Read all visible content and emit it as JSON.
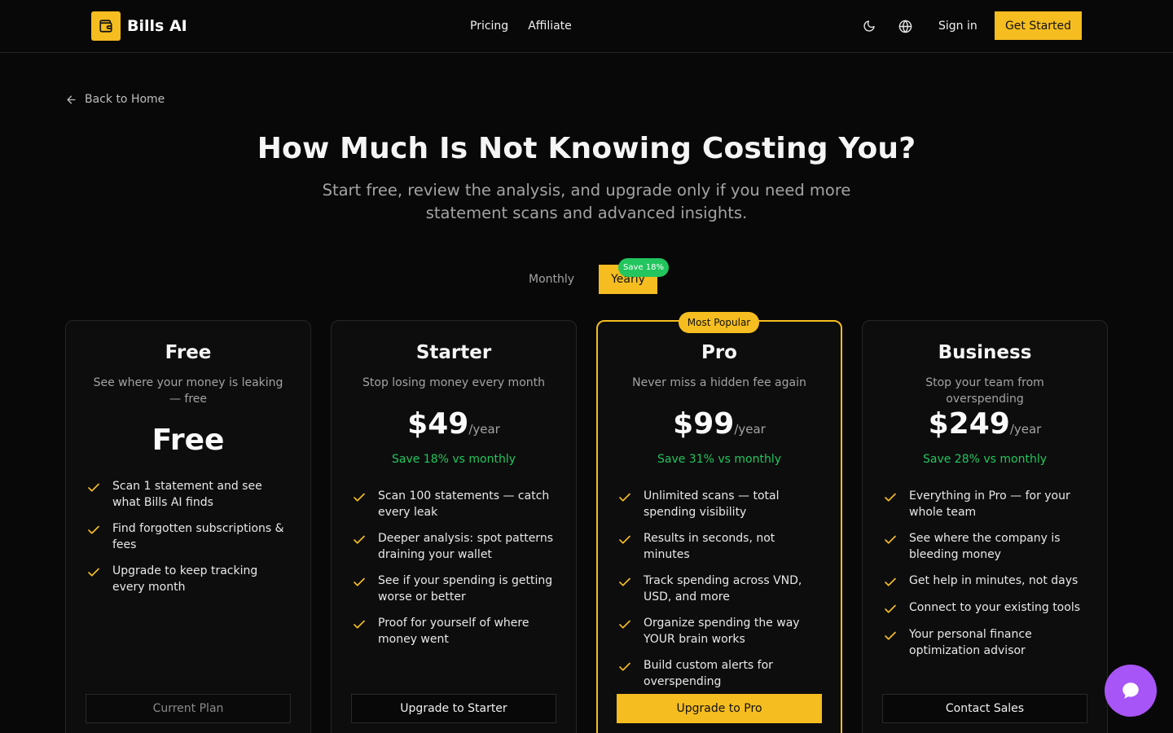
{
  "header": {
    "brand": "Bills AI",
    "nav": [
      {
        "label": "Pricing"
      },
      {
        "label": "Affiliate"
      }
    ],
    "theme_icon": "moon-icon",
    "language_icon": "globe-icon",
    "signin": "Sign in",
    "cta": "Get Started"
  },
  "back_link": "Back to Home",
  "hero": {
    "title": "How Much Is Not Knowing Costing You?",
    "subtitle": "Start free, review the analysis, and upgrade only if you need more statement scans and advanced insights."
  },
  "billing_toggle": {
    "monthly": "Monthly",
    "yearly": "Yearly",
    "yearly_selected": true,
    "save_badge": "Save 18%"
  },
  "plans": [
    {
      "name": "Free",
      "description": "See where your money is leaking — free",
      "price": "Free",
      "features": [
        "Scan 1 statement and see what Bills AI finds",
        "Find forgotten subscriptions & fees",
        "Upgrade to keep tracking every month"
      ],
      "button": "Current Plan"
    },
    {
      "name": "Starter",
      "description": "Stop losing money every month",
      "price": "$49",
      "period": "/year",
      "savings": "Save 18% vs monthly",
      "features": [
        "Scan 100 statements — catch every leak",
        "Deeper analysis: spot patterns draining your wallet",
        "See if your spending is getting worse or better",
        "Proof for yourself of where money went"
      ],
      "button": "Upgrade to Starter"
    },
    {
      "name": "Pro",
      "badge": "Most Popular",
      "description": "Never miss a hidden fee again",
      "price": "$99",
      "period": "/year",
      "savings": "Save 31% vs monthly",
      "features": [
        "Unlimited scans — total spending visibility",
        "Results in seconds, not minutes",
        "Track spending across VND, USD, and more",
        "Organize spending the way YOUR brain works",
        "Build custom alerts for overspending"
      ],
      "button": "Upgrade to Pro"
    },
    {
      "name": "Business",
      "description": "Stop your team from overspending",
      "price": "$249",
      "period": "/year",
      "savings": "Save 28% vs monthly",
      "features": [
        "Everything in Pro — for your whole team",
        "See where the company is bleeding money",
        "Get help in minutes, not days",
        "Connect to your existing tools",
        "Your personal finance optimization advisor"
      ],
      "button": "Contact Sales"
    }
  ],
  "colors": {
    "accent": "#f5bd1f",
    "success": "#22c55e",
    "chat": "#a855f7",
    "background": "#080808"
  },
  "chat_icon": "chat-bubble-icon"
}
